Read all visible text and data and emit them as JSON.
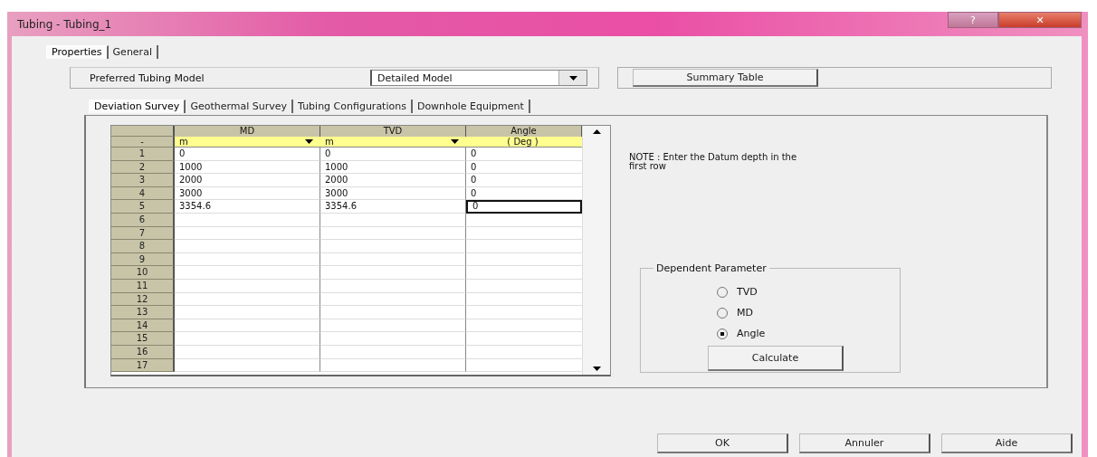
{
  "window": {
    "title": "Tubing - Tubing_1",
    "title_buttons": [
      {
        "kind": "help",
        "label": "?"
      },
      {
        "kind": "close",
        "label": "✕"
      }
    ]
  },
  "tabs": [
    {
      "label": "Properties",
      "selected": true
    },
    {
      "label": "General",
      "selected": false
    }
  ],
  "model": {
    "label": "Preferred Tubing Model",
    "value": "Detailed Model",
    "summary_button": "Summary Table"
  },
  "inner_tabs": [
    {
      "label": "Deviation Survey",
      "selected": true
    },
    {
      "label": "Geothermal Survey",
      "selected": false
    },
    {
      "label": "Tubing Configurations",
      "selected": false
    },
    {
      "label": "Downhole Equipment",
      "selected": false
    }
  ],
  "grid": {
    "corner": "-",
    "columns": [
      {
        "header": "MD",
        "unit": "m",
        "unit_dropdown": true
      },
      {
        "header": "TVD",
        "unit": "m",
        "unit_dropdown": true
      },
      {
        "header": "Angle",
        "unit": "( Deg )",
        "unit_dropdown": false
      }
    ],
    "rows": [
      {
        "number": "1",
        "cells": [
          {
            "text": "0",
            "selected": false
          },
          {
            "text": "0",
            "selected": false
          },
          {
            "text": "0",
            "selected": false
          }
        ]
      },
      {
        "number": "2",
        "cells": [
          {
            "text": "1000",
            "selected": false
          },
          {
            "text": "1000",
            "selected": false
          },
          {
            "text": "0",
            "selected": false
          }
        ]
      },
      {
        "number": "3",
        "cells": [
          {
            "text": "2000",
            "selected": false
          },
          {
            "text": "2000",
            "selected": false
          },
          {
            "text": "0",
            "selected": false
          }
        ]
      },
      {
        "number": "4",
        "cells": [
          {
            "text": "3000",
            "selected": false
          },
          {
            "text": "3000",
            "selected": false
          },
          {
            "text": "0",
            "selected": false
          }
        ]
      },
      {
        "number": "5",
        "cells": [
          {
            "text": "3354.6",
            "selected": false
          },
          {
            "text": "3354.6",
            "selected": false
          },
          {
            "text": "0",
            "selected": true
          }
        ]
      },
      {
        "number": "6",
        "cells": [
          {
            "selected": false
          },
          {
            "selected": false
          },
          {
            "selected": false
          }
        ]
      },
      {
        "number": "7",
        "cells": [
          {
            "selected": false
          },
          {
            "selected": false
          },
          {
            "selected": false
          }
        ]
      },
      {
        "number": "8",
        "cells": [
          {
            "selected": false
          },
          {
            "selected": false
          },
          {
            "selected": false
          }
        ]
      },
      {
        "number": "9",
        "cells": [
          {
            "selected": false
          },
          {
            "selected": false
          },
          {
            "selected": false
          }
        ]
      },
      {
        "number": "10",
        "cells": [
          {
            "selected": false
          },
          {
            "selected": false
          },
          {
            "selected": false
          }
        ]
      },
      {
        "number": "11",
        "cells": [
          {
            "selected": false
          },
          {
            "selected": false
          },
          {
            "selected": false
          }
        ]
      },
      {
        "number": "12",
        "cells": [
          {
            "selected": false
          },
          {
            "selected": false
          },
          {
            "selected": false
          }
        ]
      },
      {
        "number": "13",
        "cells": [
          {
            "selected": false
          },
          {
            "selected": false
          },
          {
            "selected": false
          }
        ]
      },
      {
        "number": "14",
        "cells": [
          {
            "selected": false
          },
          {
            "selected": false
          },
          {
            "selected": false
          }
        ]
      },
      {
        "number": "15",
        "cells": [
          {
            "selected": false
          },
          {
            "selected": false
          },
          {
            "selected": false
          }
        ]
      },
      {
        "number": "16",
        "cells": [
          {
            "selected": false
          },
          {
            "selected": false
          },
          {
            "selected": false
          }
        ]
      },
      {
        "number": "17",
        "cells": [
          {
            "selected": false
          },
          {
            "selected": false
          },
          {
            "selected": false
          }
        ]
      }
    ]
  },
  "note": "NOTE : Enter the Datum depth in the first row",
  "dependent_parameter": {
    "title": "Dependent Parameter",
    "options": [
      {
        "label": "TVD",
        "selected": false
      },
      {
        "label": "MD",
        "selected": false
      },
      {
        "label": "Angle",
        "selected": true
      }
    ],
    "button": "Calculate"
  },
  "buttons": [
    "OK",
    "Annuler",
    "Aide"
  ]
}
